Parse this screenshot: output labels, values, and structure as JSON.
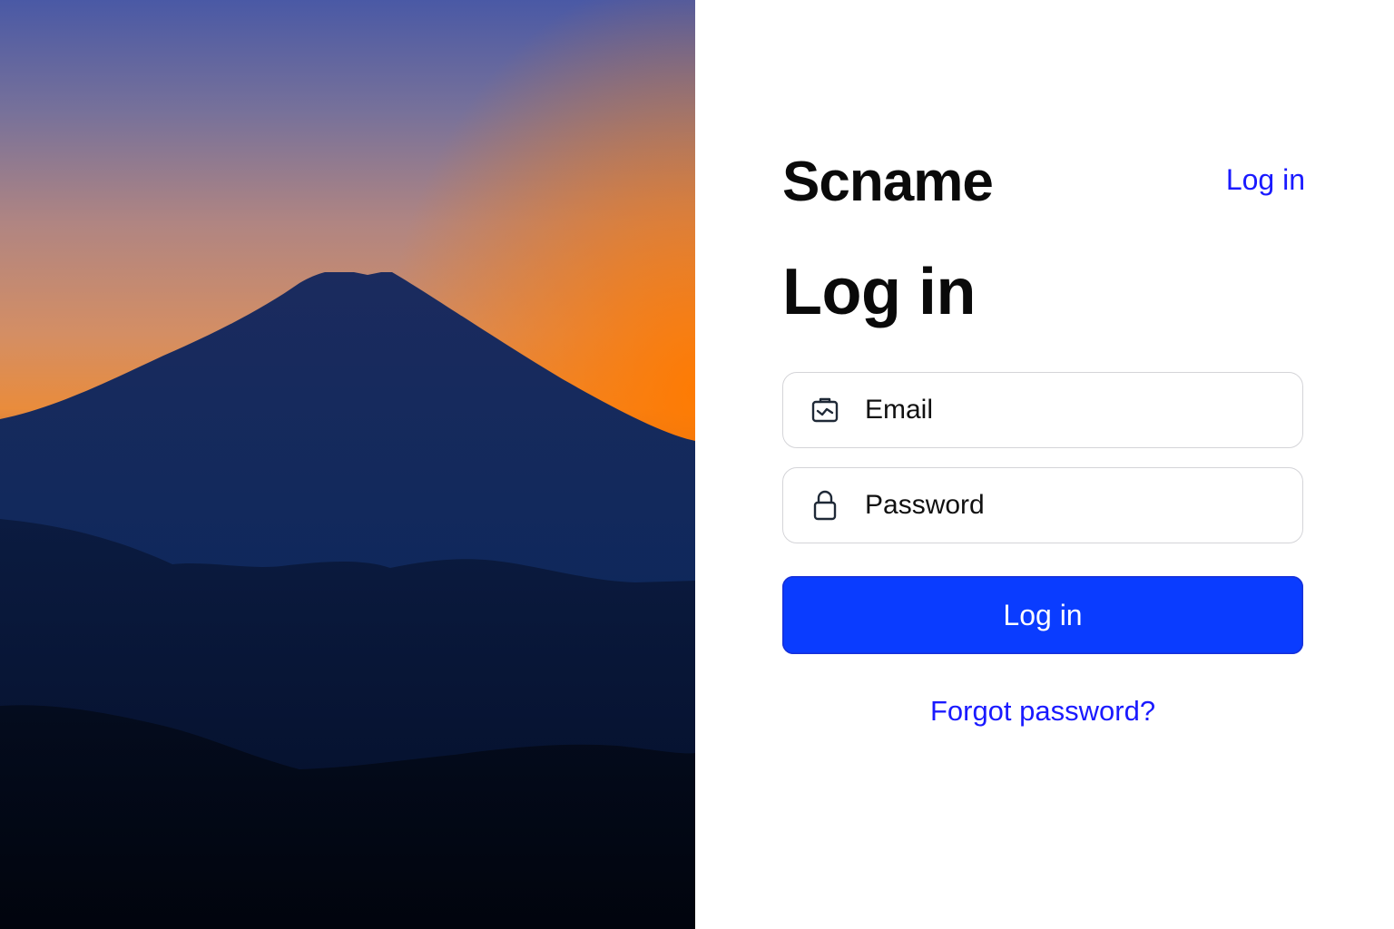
{
  "hero": {
    "image": "mountain-sunset-photo",
    "colors": {
      "sky_top": "#4b5aa6",
      "sky_mid": "#c08a78",
      "sky_glow": "#ff7a00",
      "mountain": "#0f2556",
      "hills": "#050b1f"
    }
  },
  "brand": {
    "name": "Scname"
  },
  "header": {
    "login_link": "Log in"
  },
  "form": {
    "title": "Log in",
    "email": {
      "placeholder": "Email",
      "value": "",
      "icon": "email-icon"
    },
    "password": {
      "placeholder": "Password",
      "value": "",
      "icon": "lock-icon"
    },
    "submit_label": "Log in",
    "forgot_label": "Forgot password?"
  },
  "colors": {
    "accent": "#0a3cff",
    "link": "#1a1aff",
    "text": "#0a0a0a",
    "border": "#d4d4d8"
  }
}
